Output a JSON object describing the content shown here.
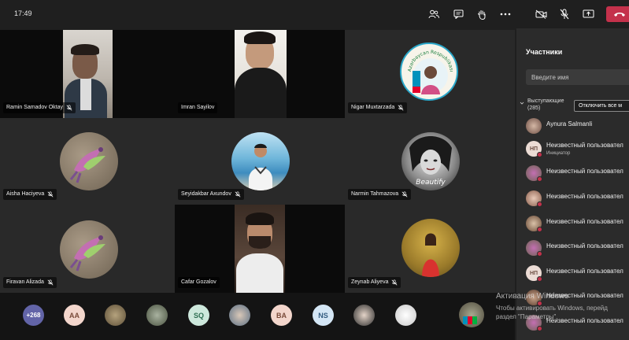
{
  "clock": "17:49",
  "panel": {
    "title": "Участники",
    "search_placeholder": "Введите имя",
    "section_label": "Выступающие",
    "section_count": "(285)",
    "mute_all_label": "Отключить все м",
    "participants": [
      {
        "name": "Aynura Salmanli",
        "initials": "",
        "role": ""
      },
      {
        "name": "Неизвестный пользовател",
        "initials": "НП",
        "role": "Инициатор"
      },
      {
        "name": "Неизвестный пользовател",
        "initials": "",
        "role": ""
      },
      {
        "name": "Неизвестный пользовател",
        "initials": "",
        "role": ""
      },
      {
        "name": "Неизвестный пользовател",
        "initials": "",
        "role": ""
      },
      {
        "name": "Неизвестный пользовател",
        "initials": "",
        "role": ""
      },
      {
        "name": "Неизвестный пользовател",
        "initials": "НП",
        "role": ""
      },
      {
        "name": "Неизвестный пользовател",
        "initials": "",
        "role": ""
      },
      {
        "name": "Неизвестный пользовател",
        "initials": "",
        "role": ""
      }
    ]
  },
  "tiles": [
    {
      "name": "Ramin Samadov Oktay"
    },
    {
      "name": "Imran Sayilov"
    },
    {
      "name": "Nigar Muxtarzada"
    },
    {
      "name": "Aisha Haciyeva"
    },
    {
      "name": "Seyidakbar Axundov"
    },
    {
      "name": "Narmin Tahmazova"
    },
    {
      "name": "Firavan Alizada"
    },
    {
      "name": "Cafar Gozalov"
    },
    {
      "name": "Zeynab Aliyeva"
    }
  ],
  "avatar_texts": {
    "seal_text": "Azərbaycan Respublikası",
    "beautify": "Beautify"
  },
  "strip": {
    "more_count": "+268",
    "initials": [
      "AA",
      "SQ",
      "BA",
      "NS"
    ]
  },
  "watermark": {
    "line1": "Активация Windows",
    "line2": "Чтобы активировать Windows, перейд",
    "line3": "раздел \"Параметры\"."
  },
  "colors": {
    "accent": "#6264a7",
    "hangup": "#c4314b",
    "background": "#1f1f1f"
  }
}
